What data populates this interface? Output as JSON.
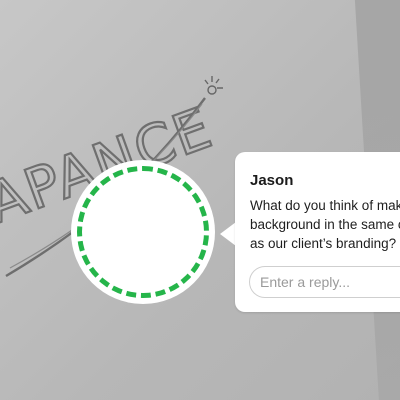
{
  "background_sketch": {
    "text": "APANCE"
  },
  "comment_marker": {
    "border_color": "#25b54a"
  },
  "comment": {
    "author": "Jason",
    "message_lines": [
      "What do you think of mak",
      "background in the same c",
      "as our client’s branding?"
    ],
    "reply_placeholder": "Enter a reply..."
  }
}
